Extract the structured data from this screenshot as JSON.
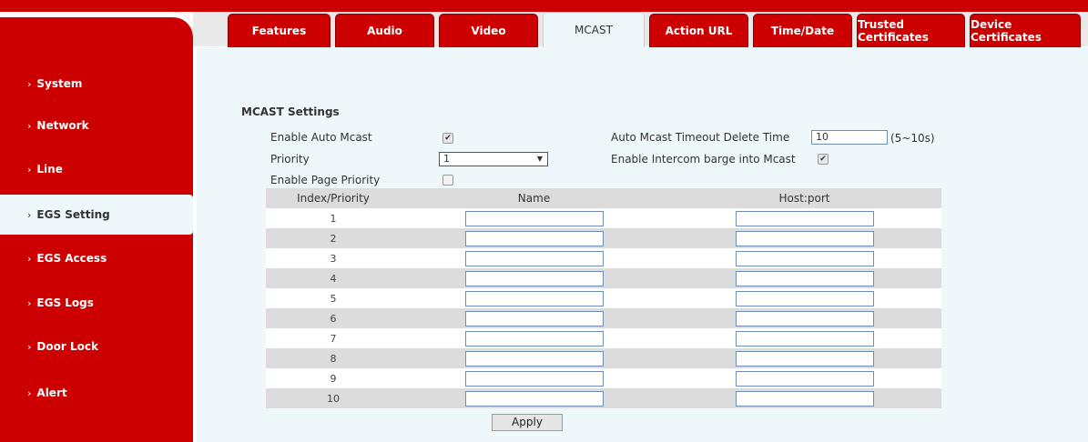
{
  "tabs": [
    {
      "label": "Features",
      "active": false
    },
    {
      "label": "Audio",
      "active": false
    },
    {
      "label": "Video",
      "active": false
    },
    {
      "label": "MCAST",
      "active": true
    },
    {
      "label": "Action URL",
      "active": false
    },
    {
      "label": "Time/Date",
      "active": false
    },
    {
      "label": "Trusted Certificates",
      "active": false
    },
    {
      "label": "Device Certificates",
      "active": false
    }
  ],
  "sidebar": {
    "items": [
      {
        "label": "System",
        "active": false
      },
      {
        "label": "Network",
        "active": false
      },
      {
        "label": "Line",
        "active": false
      },
      {
        "label": "EGS Setting",
        "active": true
      },
      {
        "label": "EGS Access",
        "active": false
      },
      {
        "label": "EGS Logs",
        "active": false
      },
      {
        "label": "Door Lock",
        "active": false
      },
      {
        "label": "Alert",
        "active": false
      }
    ],
    "chevron": "›"
  },
  "mcast": {
    "title": "MCAST Settings",
    "enable_auto_mcast_label": "Enable Auto Mcast",
    "enable_auto_mcast_checked": true,
    "priority_label": "Priority",
    "priority_value": "1",
    "enable_page_priority_label": "Enable Page Priority",
    "enable_page_priority_checked": false,
    "timeout_label": "Auto Mcast Timeout Delete Time",
    "timeout_value": "10",
    "timeout_hint": "(5~10s)",
    "intercom_label": "Enable Intercom barge into Mcast",
    "intercom_checked": true
  },
  "table": {
    "headers": [
      "Index/Priority",
      "Name",
      "Host:port"
    ],
    "rows": [
      {
        "index": "1",
        "name": "",
        "host": ""
      },
      {
        "index": "2",
        "name": "",
        "host": ""
      },
      {
        "index": "3",
        "name": "",
        "host": ""
      },
      {
        "index": "4",
        "name": "",
        "host": ""
      },
      {
        "index": "5",
        "name": "",
        "host": ""
      },
      {
        "index": "6",
        "name": "",
        "host": ""
      },
      {
        "index": "7",
        "name": "",
        "host": ""
      },
      {
        "index": "8",
        "name": "",
        "host": ""
      },
      {
        "index": "9",
        "name": "",
        "host": ""
      },
      {
        "index": "10",
        "name": "",
        "host": ""
      }
    ]
  },
  "apply_label": "Apply",
  "colors": {
    "brand": "#cc0000",
    "content_bg": "#eef8fb"
  }
}
